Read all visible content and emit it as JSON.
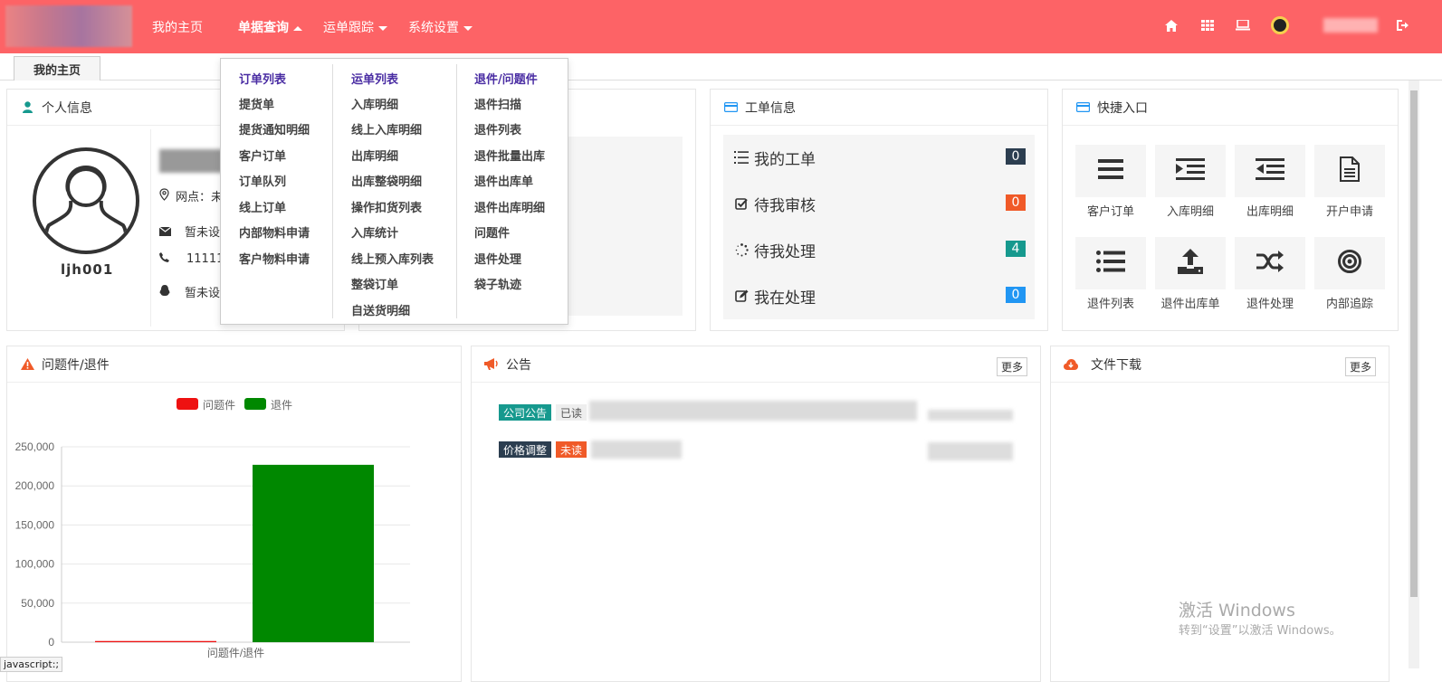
{
  "nav": {
    "items": [
      {
        "label": "我的主页"
      },
      {
        "label": "单据查询"
      },
      {
        "label": "运单跟踪"
      },
      {
        "label": "系统设置"
      }
    ]
  },
  "tabs": [
    {
      "label": "我的主页"
    }
  ],
  "personal": {
    "title": "个人信息",
    "username": "ljh001",
    "branch_label": "网点：",
    "branch_value": "未",
    "email_value": "暂未设",
    "phone_value": "111111",
    "qq_value": "暂未设"
  },
  "work_orders": {
    "title": "工单信息",
    "rows": [
      {
        "label": "我的工单",
        "count": "0",
        "color": "#2c3e50"
      },
      {
        "label": "待我审核",
        "count": "0",
        "color": "#f05a28"
      },
      {
        "label": "待我处理",
        "count": "4",
        "color": "#16998e"
      },
      {
        "label": "我在处理",
        "count": "0",
        "color": "#2196f3"
      }
    ]
  },
  "quick_entry": {
    "title": "快捷入口",
    "items": [
      {
        "label": "客户订单",
        "icon": "list-icon"
      },
      {
        "label": "入库明细",
        "icon": "indent-icon"
      },
      {
        "label": "出库明细",
        "icon": "outdent-icon"
      },
      {
        "label": "开户申请",
        "icon": "document-icon"
      },
      {
        "label": "退件列表",
        "icon": "bullet-list-icon"
      },
      {
        "label": "退件出库单",
        "icon": "upload-icon"
      },
      {
        "label": "退件处理",
        "icon": "shuffle-icon"
      },
      {
        "label": "内部追踪",
        "icon": "target-icon"
      }
    ]
  },
  "problems": {
    "title": "问题件/退件"
  },
  "chart_data": {
    "type": "bar",
    "categories": [
      "问题件/退件"
    ],
    "series": [
      {
        "name": "问题件",
        "values": [
          1500
        ],
        "color": "#ee1111"
      },
      {
        "name": "退件",
        "values": [
          227000
        ],
        "color": "#008800"
      }
    ],
    "xlabel": "问题件/退件",
    "ylim": [
      0,
      250000
    ],
    "yticks": [
      "0",
      "50,000",
      "100,000",
      "150,000",
      "200,000",
      "250,000"
    ],
    "legend": "top-center",
    "grid": true
  },
  "announcement": {
    "title": "公告",
    "more": "更多",
    "items": [
      {
        "tag": "公司公告",
        "tag_color": "#16998e",
        "status": "已读",
        "status_color": "#555"
      },
      {
        "tag": "价格调整",
        "tag_color": "#2c3e50",
        "status": "未读",
        "status_color": "#f05a28"
      }
    ]
  },
  "downloads": {
    "title": "文件下载",
    "more": "更多"
  },
  "dropdown": {
    "columns": [
      {
        "header": "订单列表",
        "items": [
          "提货单",
          "提货通知明细",
          "客户订单",
          "订单队列",
          "线上订单",
          "内部物料申请",
          "客户物料申请"
        ]
      },
      {
        "header": "运单列表",
        "items": [
          "入库明细",
          "线上入库明细",
          "出库明细",
          "出库整袋明细",
          "操作扣货列表",
          "入库统计",
          "线上预入库列表",
          "整袋订单",
          "自送货明细"
        ]
      },
      {
        "header": "退件/问题件",
        "items": [
          "退件扫描",
          "退件列表",
          "退件批量出库",
          "退件出库单",
          "退件出库明细",
          "问题件",
          "退件处理",
          "袋子轨迹"
        ]
      }
    ]
  },
  "watermark": {
    "line1": "激活 Windows",
    "line2": "转到“设置”以激活 Windows。"
  },
  "status_bar": "javascript:;",
  "colors": {
    "topbar": "#fd6366",
    "dropdown_header": "#4a2da3"
  }
}
